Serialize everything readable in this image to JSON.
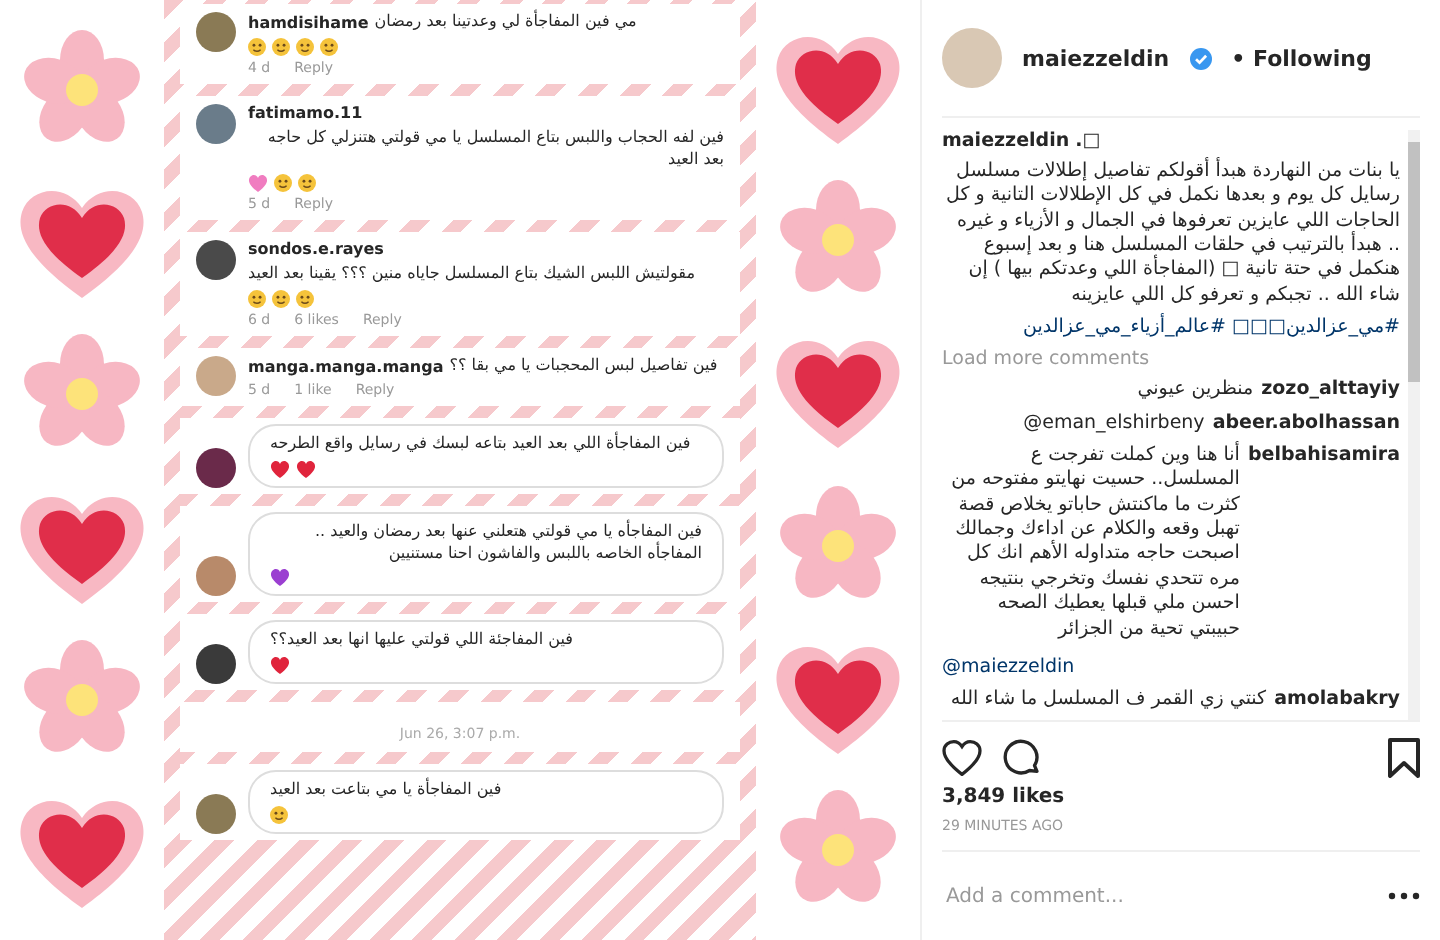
{
  "post_image": {
    "comment_cards": [
      {
        "kind": "comment",
        "username": "hamdisihame",
        "text": "مي فين المفاجأة لي وعدتينا بعد رمضان",
        "emojis": [
          {
            "kind": "face"
          },
          {
            "kind": "face"
          },
          {
            "kind": "face"
          },
          {
            "kind": "face"
          }
        ],
        "age": "4 d",
        "reply": "Reply"
      },
      {
        "kind": "comment",
        "username": "fatimamo.11",
        "text": "فين لفه الحجاب واللبس بتاع المسلسل يا مي قولتي هتنزلي كل حاجه بعد العيد",
        "emojis": [
          {
            "kind": "pink_heart"
          },
          {
            "kind": "face"
          },
          {
            "kind": "face"
          }
        ],
        "age": "5 d",
        "reply": "Reply"
      },
      {
        "kind": "comment",
        "username": "sondos.e.rayes",
        "text": "مقولتيش اللبس الشيك بتاع المسلسل جاياه منين ؟؟؟ يقينا بعد العيد",
        "emojis": [
          {
            "kind": "face"
          },
          {
            "kind": "face"
          },
          {
            "kind": "face"
          }
        ],
        "age": "6 d",
        "likes": "6 likes",
        "reply": "Reply"
      },
      {
        "kind": "comment",
        "username": "manga.manga.manga",
        "text": "فين تفاصيل لبس المحجبات يا مي بقا ؟؟",
        "age": "5 d",
        "likes": "1 like",
        "reply": "Reply"
      },
      {
        "kind": "bubble",
        "text": "فين المفاجأة اللي بعد العيد بتاعه لبسك في رسايل واقع الطرحه",
        "emojis": [
          {
            "kind": "heart"
          },
          {
            "kind": "heart"
          }
        ]
      },
      {
        "kind": "bubble",
        "text": "فين المفاجأه يا مي قولتي هتعلني عنها بعد رمضان والعيد .. المفاجأه الخاصه باللبس والفاشون احنا مستنيين",
        "emojis": [
          {
            "kind": "purple_heart"
          }
        ]
      },
      {
        "kind": "bubble",
        "text": "فين المفاجئة اللي قولتي عليها انها بعد العيد؟؟",
        "emojis": [
          {
            "kind": "heart"
          }
        ]
      },
      {
        "kind": "date",
        "text": "Jun 26, 3:07 p.m."
      },
      {
        "kind": "bubble",
        "text": "فين المفاجأة يا مي بتاعت بعد العيد",
        "emojis": [
          {
            "kind": "face"
          }
        ]
      }
    ]
  },
  "post_header": {
    "username": "maiezzeldin",
    "verified": true,
    "follow_status": "• Following"
  },
  "caption": {
    "username": "maiezzeldin",
    "suffix": ".□",
    "text": "يا بنات من النهاردة هبدأ أقولكم تفاصيل إطلالات مسلسل رسايل كل يوم و بعدها نكمل في كل الإطلالات التانية و كل الحاجات اللي عايزين تعرفوها في الجمال و الأزياء و غيره .. هبدأ بالترتيب في حلقات المسلسل هنا و بعد إسبوع هنكمل في حتة تانية □ (المفاجأة اللي وعدتكم بيها ) إن شاء الله .. تجبكم و تعرفو كل اللي عايزينه",
    "hashtags": "#مي_عزالدين□□□ #عالم_أزياء_مي_عزالدين"
  },
  "load_more": "Load more comments",
  "comments": [
    {
      "username": "zozo_alttayiy",
      "text": "منظرين عيوني"
    },
    {
      "username": "abeer.abolhassan",
      "text": "@eman_elshirbeny"
    },
    {
      "username": "belbahisamira",
      "text": "أنا هنا وين كملت تفرجت ع المسلسل.. حسيت نهايتو مفتوحه من كثرت ما ماكنتش حاباتو يخلاص قصة تهبل وقعه والكلام عن اداءك وجمالك اصبحت حاجه متداوله الأهم انك كل مره تتحدي نفسك وتخرجي بنتيجه احسن ملي قبلها يعطيك الصحه حبيبتي تحية من الجزائر",
      "mention": "@maiezzeldin"
    },
    {
      "username": "amolabakry",
      "text": "كنتي زي القمر ف المسلسل ما شاء الله"
    }
  ],
  "likes": "3,849 likes",
  "time": "29 MINUTES AGO",
  "add_comment": {
    "placeholder": "Add a comment..."
  }
}
